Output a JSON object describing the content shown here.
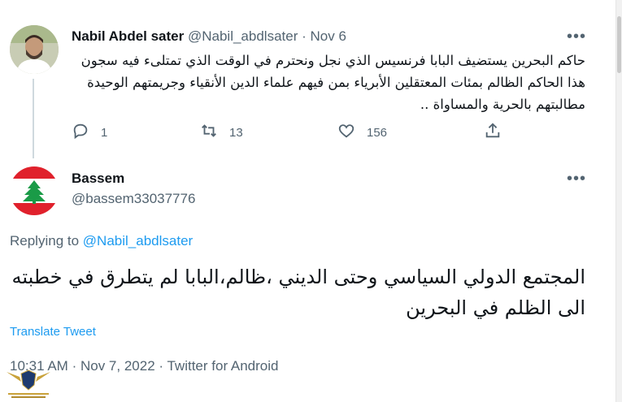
{
  "parent_tweet": {
    "author_name": "Nabil Abdel sater",
    "author_handle": "@Nabil_abdlsater",
    "separator": "·",
    "date": "Nov 6",
    "text": "حاكم البحرين يستضيف البابا فرنسيس الذي نجل ونحترم في الوقت الذي تمتلىء فيه سجون هذا الحاكم الظالم بمئات المعتقلين الأبرياء بمن فيهم علماء الدين الأنقياء وجريمتهم الوحيدة مطالبتهم بالحرية والمساواة ..",
    "reply_count": "1",
    "retweet_count": "13",
    "like_count": "156",
    "more_label": "•••"
  },
  "reply_tweet": {
    "author_name": "Bassem",
    "author_handle": "@bassem33037776",
    "replying_prefix": "Replying to",
    "replying_to": "@Nabil_abdlsater",
    "text": "المجتمع الدولي السياسي وحتى الديني ،ظالم،البابا لم يتطرق في خطبته الى الظلم في البحرين",
    "translate_label": "Translate Tweet",
    "time": "10:31 AM",
    "separator": "·",
    "date": "Nov 7, 2022",
    "source": "Twitter for Android",
    "more_label": "•••"
  },
  "colors": {
    "link": "#1d9bf0",
    "secondary_text": "#536471",
    "primary_text": "#0f1419"
  },
  "icons": [
    "reply-icon",
    "retweet-icon",
    "like-icon",
    "share-icon",
    "more-icon"
  ]
}
